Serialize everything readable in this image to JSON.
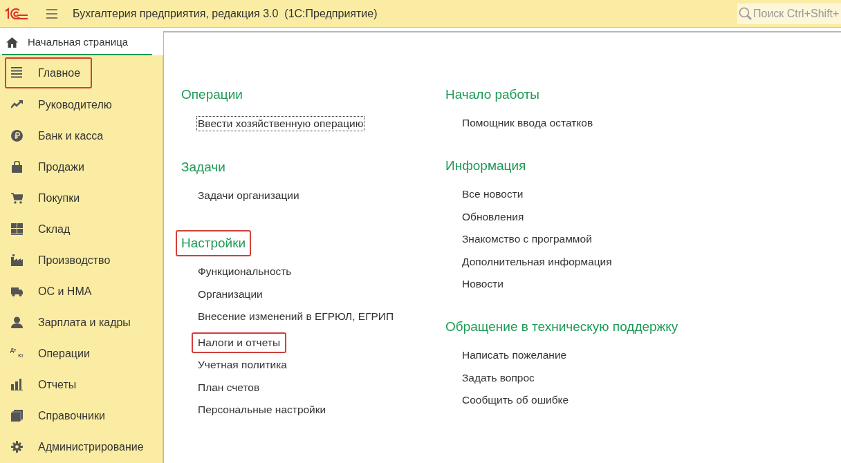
{
  "window": {
    "title": "Бухгалтерия предприятия, редакция 3.0  (1С:Предприятие)"
  },
  "search": {
    "placeholder": "Поиск Ctrl+Shift+"
  },
  "tab": {
    "label": "Начальная страница",
    "selected": true
  },
  "sidebar": {
    "items": [
      {
        "label": "Главное",
        "highlighted": true
      },
      {
        "label": "Руководителю",
        "highlighted": false
      },
      {
        "label": "Банк и касса",
        "highlighted": false
      },
      {
        "label": "Продажи",
        "highlighted": false
      },
      {
        "label": "Покупки",
        "highlighted": false
      },
      {
        "label": "Склад",
        "highlighted": false
      },
      {
        "label": "Производство",
        "highlighted": false
      },
      {
        "label": "ОС и НМА",
        "highlighted": false
      },
      {
        "label": "Зарплата и кадры",
        "highlighted": false
      },
      {
        "label": "Операции",
        "highlighted": false,
        "icon_text": [
          "Дт",
          "Кт"
        ]
      },
      {
        "label": "Отчеты",
        "highlighted": false
      },
      {
        "label": "Справочники",
        "highlighted": false
      },
      {
        "label": "Администрирование",
        "highlighted": false
      }
    ]
  },
  "columns": [
    {
      "sections": [
        {
          "title": "Операции",
          "highlighted": false,
          "links": [
            {
              "label": "Ввести хозяйственную операцию",
              "highlighted": false,
              "focused": true
            }
          ]
        },
        {
          "title": "Задачи",
          "highlighted": false,
          "links": [
            {
              "label": "Задачи организации",
              "highlighted": false,
              "focused": false
            }
          ]
        },
        {
          "title": "Настройки",
          "highlighted": true,
          "links": [
            {
              "label": "Функциональность",
              "highlighted": false,
              "focused": false
            },
            {
              "label": "Организации",
              "highlighted": false,
              "focused": false
            },
            {
              "label": "Внесение изменений в ЕГРЮЛ, ЕГРИП",
              "highlighted": false,
              "focused": false
            },
            {
              "label": "Налоги и отчеты",
              "highlighted": true,
              "focused": false
            },
            {
              "label": "Учетная политика",
              "highlighted": false,
              "focused": false
            },
            {
              "label": "План счетов",
              "highlighted": false,
              "focused": false
            },
            {
              "label": "Персональные настройки",
              "highlighted": false,
              "focused": false
            }
          ]
        }
      ]
    },
    {
      "sections": [
        {
          "title": "Начало работы",
          "highlighted": false,
          "links": [
            {
              "label": "Помощник ввода остатков",
              "highlighted": false,
              "focused": false
            }
          ]
        },
        {
          "title": "Информация",
          "highlighted": false,
          "links": [
            {
              "label": "Все новости",
              "highlighted": false,
              "focused": false
            },
            {
              "label": "Обновления",
              "highlighted": false,
              "focused": false
            },
            {
              "label": "Знакомство с программой",
              "highlighted": false,
              "focused": false
            },
            {
              "label": "Дополнительная информация",
              "highlighted": false,
              "focused": false
            },
            {
              "label": "Новости",
              "highlighted": false,
              "focused": false
            }
          ]
        },
        {
          "title": "Обращение в техническую поддержку",
          "highlighted": false,
          "links": [
            {
              "label": "Написать пожелание",
              "highlighted": false,
              "focused": false
            },
            {
              "label": "Задать вопрос",
              "highlighted": false,
              "focused": false
            },
            {
              "label": "Сообщить об ошибке",
              "highlighted": false,
              "focused": false
            }
          ]
        }
      ]
    }
  ]
}
